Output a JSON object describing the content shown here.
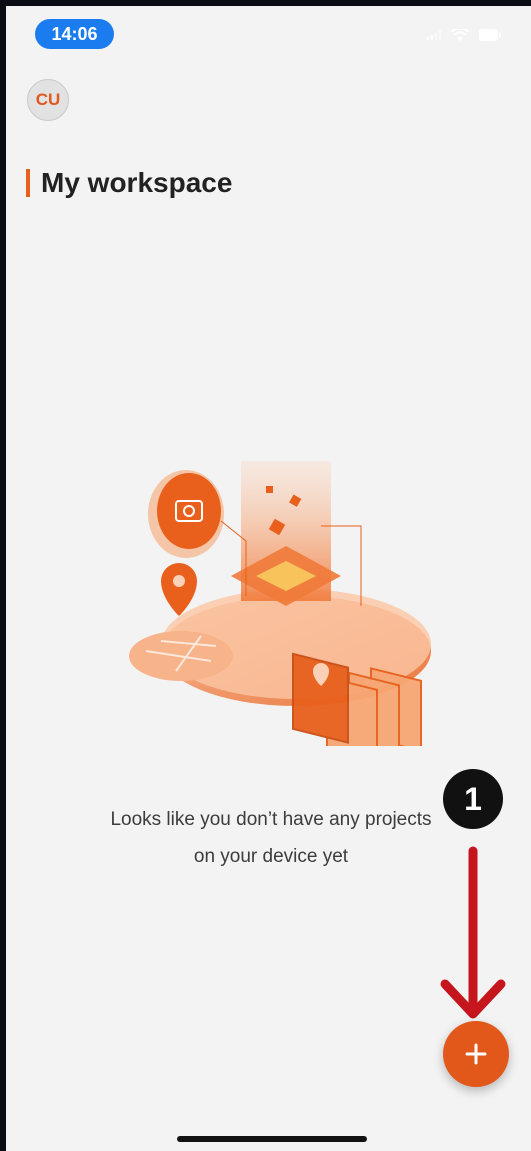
{
  "status_bar": {
    "time": "14:06"
  },
  "header": {
    "avatar_initials": "CU",
    "title": "My workspace"
  },
  "empty_state": {
    "message_line1": "Looks like you don’t have any projects",
    "message_line2": "on your device yet",
    "illustration_icon": "workspace-illustration"
  },
  "annotation": {
    "step_number": "1",
    "arrow_color": "#c4161c"
  },
  "fab": {
    "icon": "plus-icon",
    "color": "#e2581a"
  },
  "colors": {
    "accent": "#e8601c",
    "status_pill": "#1b7cf0",
    "background": "#f3f3f3"
  }
}
